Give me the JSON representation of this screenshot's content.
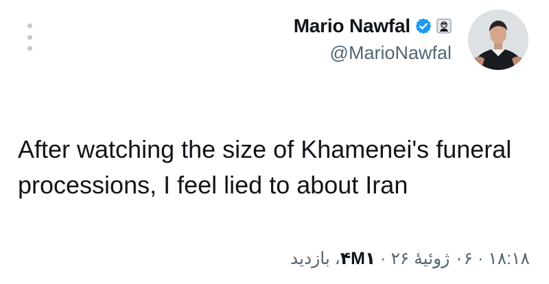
{
  "author": {
    "display_name": "Mario Nawfal",
    "handle": "@MarioNawfal",
    "verified_color": "#1d9bf0"
  },
  "icons": {
    "more": "more-vertical-icon",
    "verified": "verified-badge-icon",
    "affiliate": "affiliate-badge-icon",
    "avatar": "profile-photo"
  },
  "tweet": {
    "text": "After watching the size of Khamenei's funeral processions, I feel lied to about Iran"
  },
  "meta": {
    "time": "۱۸:۱۸",
    "separator_1": " · ",
    "date": "۰۶ ژوئیهٔ ۲۶",
    "separator_2": " · ",
    "views_count": "۴M۱",
    "views_label": "، بازدید"
  }
}
